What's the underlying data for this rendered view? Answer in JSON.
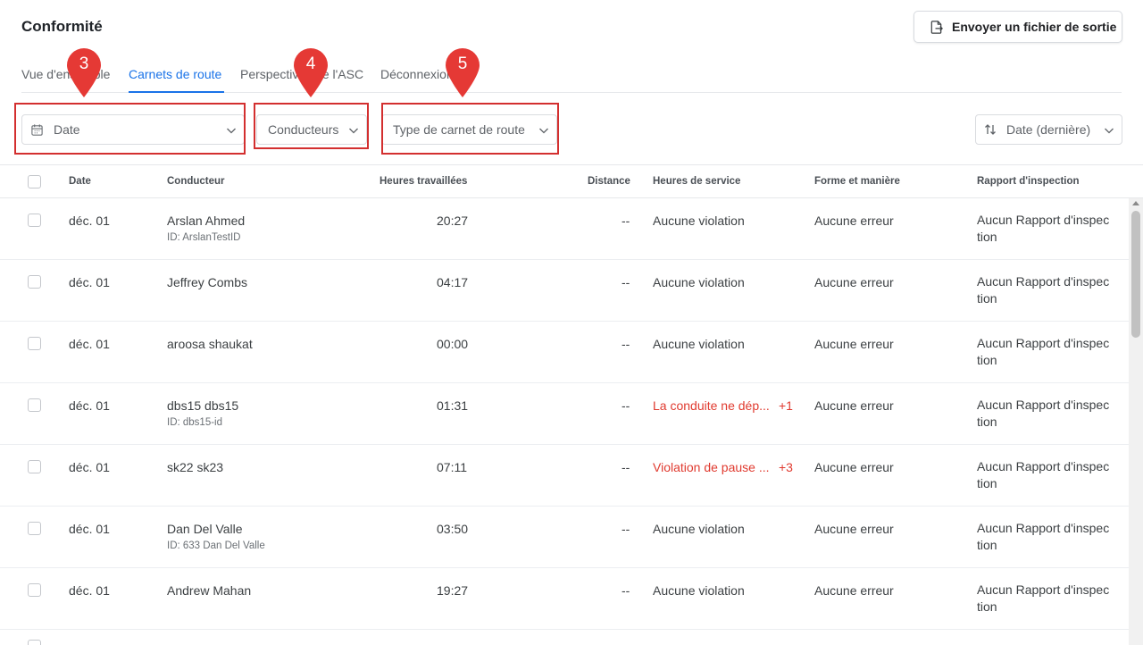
{
  "header": {
    "title": "Conformité",
    "export_label": "Envoyer un fichier de sortie"
  },
  "tabs": [
    {
      "label": "Vue d'ensemble"
    },
    {
      "label": "Carnets de route"
    },
    {
      "label": "Perspectives de l'ASC"
    },
    {
      "label": "Déconnexions"
    }
  ],
  "filters": {
    "date": "Date",
    "drivers": "Conducteurs",
    "log_type": "Type de carnet de route",
    "sort": "Date (dernière)"
  },
  "annotations": [
    "3",
    "4",
    "5"
  ],
  "columns": {
    "date": "Date",
    "driver": "Conducteur",
    "hours_worked": "Heures travaillées",
    "distance": "Distance",
    "hours_of_service": "Heures de service",
    "form_manner": "Forme et manière",
    "inspection": "Rapport d'inspection"
  },
  "rows": [
    {
      "date": "déc. 01",
      "driver": "Arslan Ahmed",
      "driver_id": "ID: ArslanTestID",
      "hours": "20:27",
      "distance": "--",
      "hos": "Aucune violation",
      "hos_extra": "",
      "form": "Aucune erreur",
      "inspection": "Aucun Rapport d'inspection"
    },
    {
      "date": "déc. 01",
      "driver": "Jeffrey Combs",
      "driver_id": "",
      "hours": "04:17",
      "distance": "--",
      "hos": "Aucune violation",
      "hos_extra": "",
      "form": "Aucune erreur",
      "inspection": "Aucun Rapport d'inspection"
    },
    {
      "date": "déc. 01",
      "driver": "aroosa shaukat",
      "driver_id": "",
      "hours": "00:00",
      "distance": "--",
      "hos": "Aucune violation",
      "hos_extra": "",
      "form": "Aucune erreur",
      "inspection": "Aucun Rapport d'inspection"
    },
    {
      "date": "déc. 01",
      "driver": "dbs15 dbs15",
      "driver_id": "ID: dbs15-id",
      "hours": "01:31",
      "distance": "--",
      "hos": "La conduite ne dép...",
      "hos_extra": "+1",
      "form": "Aucune erreur",
      "inspection": "Aucun Rapport d'inspection"
    },
    {
      "date": "déc. 01",
      "driver": "sk22 sk23",
      "driver_id": "",
      "hours": "07:11",
      "distance": "--",
      "hos": "Violation de pause ...",
      "hos_extra": "+3",
      "form": "Aucune erreur",
      "inspection": "Aucun Rapport d'inspection"
    },
    {
      "date": "déc. 01",
      "driver": "Dan Del Valle",
      "driver_id": "ID: 633 Dan Del Valle",
      "hours": "03:50",
      "distance": "--",
      "hos": "Aucune violation",
      "hos_extra": "",
      "form": "Aucune erreur",
      "inspection": "Aucun Rapport d'inspection"
    },
    {
      "date": "déc. 01",
      "driver": "Andrew Mahan",
      "driver_id": "",
      "hours": "19:27",
      "distance": "--",
      "hos": "Aucune violation",
      "hos_extra": "",
      "form": "Aucune erreur",
      "inspection": "Aucun Rapport d'inspection"
    }
  ]
}
